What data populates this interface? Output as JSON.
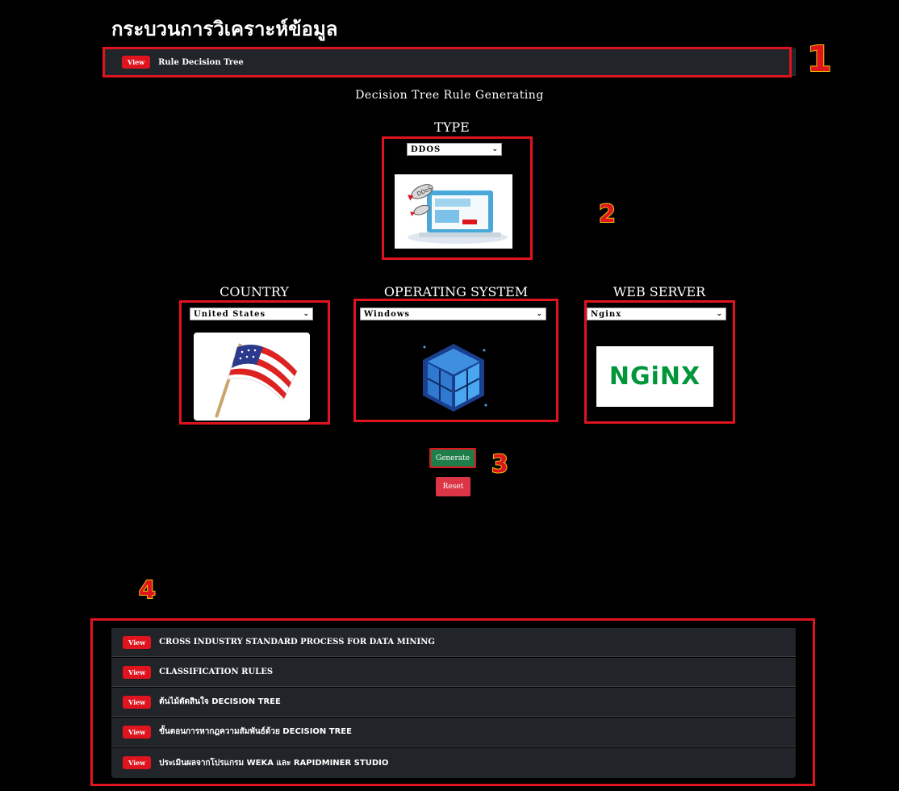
{
  "page": {
    "title": "กระบวนการวิเคราะห์ข้อมูล"
  },
  "top_accordion": {
    "view_label": "View",
    "label": "Rule Decision Tree"
  },
  "generator": {
    "heading": "Decision Tree Rule Generating",
    "type": {
      "label": "TYPE",
      "selected": "DDOS",
      "image_icon": "ddos-attack-illustration"
    },
    "country": {
      "label": "COUNTRY",
      "selected": "United States",
      "image_icon": "us-flag-illustration"
    },
    "os": {
      "label": "OPERATING SYSTEM",
      "selected": "Windows",
      "image_icon": "windows-cube-illustration"
    },
    "webserver": {
      "label": "WEB SERVER",
      "selected": "Nginx",
      "logo_text": "NGiNX"
    },
    "generate_label": "Generate",
    "reset_label": "Reset"
  },
  "annotations": {
    "n1": "1",
    "n2": "2",
    "n3": "3",
    "n4": "4"
  },
  "accordion": {
    "view_label": "View",
    "items": [
      {
        "label": "CROSS INDUSTRY STANDARD PROCESS FOR DATA MINING"
      },
      {
        "label": "CLASSIFICATION RULES"
      },
      {
        "label": "ต้นไม้ตัดสินใจ DECISION TREE"
      },
      {
        "label": "ขั้นตอนการหากฎความสัมพันธ์ด้วย DECISION TREE"
      },
      {
        "label": "ประเมินผลจากโปรแกรม WEKA และ RAPIDMINER STUDIO"
      }
    ]
  },
  "colors": {
    "accent_red": "#e0141e",
    "annotation_yellow": "#f5c400",
    "generate_green": "#1e7e4a",
    "reset_red": "#dc3545",
    "panel": "#212529"
  }
}
